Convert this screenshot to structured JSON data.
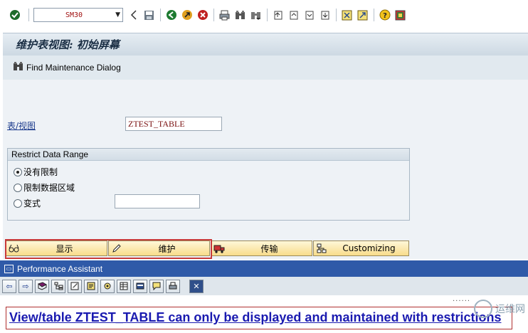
{
  "toolbar": {
    "command_value": "SM30"
  },
  "title": "维护表视图: 初始屏幕",
  "app_toolbar": {
    "find_label": "Find Maintenance Dialog"
  },
  "form": {
    "table_view_label": "表/视图",
    "table_view_value": "ZTEST_TABLE",
    "restrict_group_title": "Restrict Data Range",
    "radio_options": [
      {
        "label": "没有限制",
        "selected": true
      },
      {
        "label": "限制数据区域",
        "selected": false
      },
      {
        "label": "变式",
        "selected": false
      }
    ],
    "variant_value": ""
  },
  "buttons": [
    {
      "label": "显示",
      "icon": "glasses-icon"
    },
    {
      "label": "维护",
      "icon": "pencil-icon"
    },
    {
      "label": "传输",
      "icon": "truck-icon"
    },
    {
      "label": "Customizing",
      "icon": "hierarchy-icon"
    }
  ],
  "performance_assistant": {
    "title": "Performance Assistant",
    "message": "View/table ZTEST_TABLE can only be displayed and maintained with restrictions"
  },
  "watermark": {
    "text": "运维网"
  },
  "colors": {
    "title_bar": "#cdd9e3",
    "pa_title_bar": "#2f5aa8",
    "button_fill": "#f8dc8a",
    "message_text": "#1a1ab0",
    "highlight_border": "#c83a3a"
  }
}
